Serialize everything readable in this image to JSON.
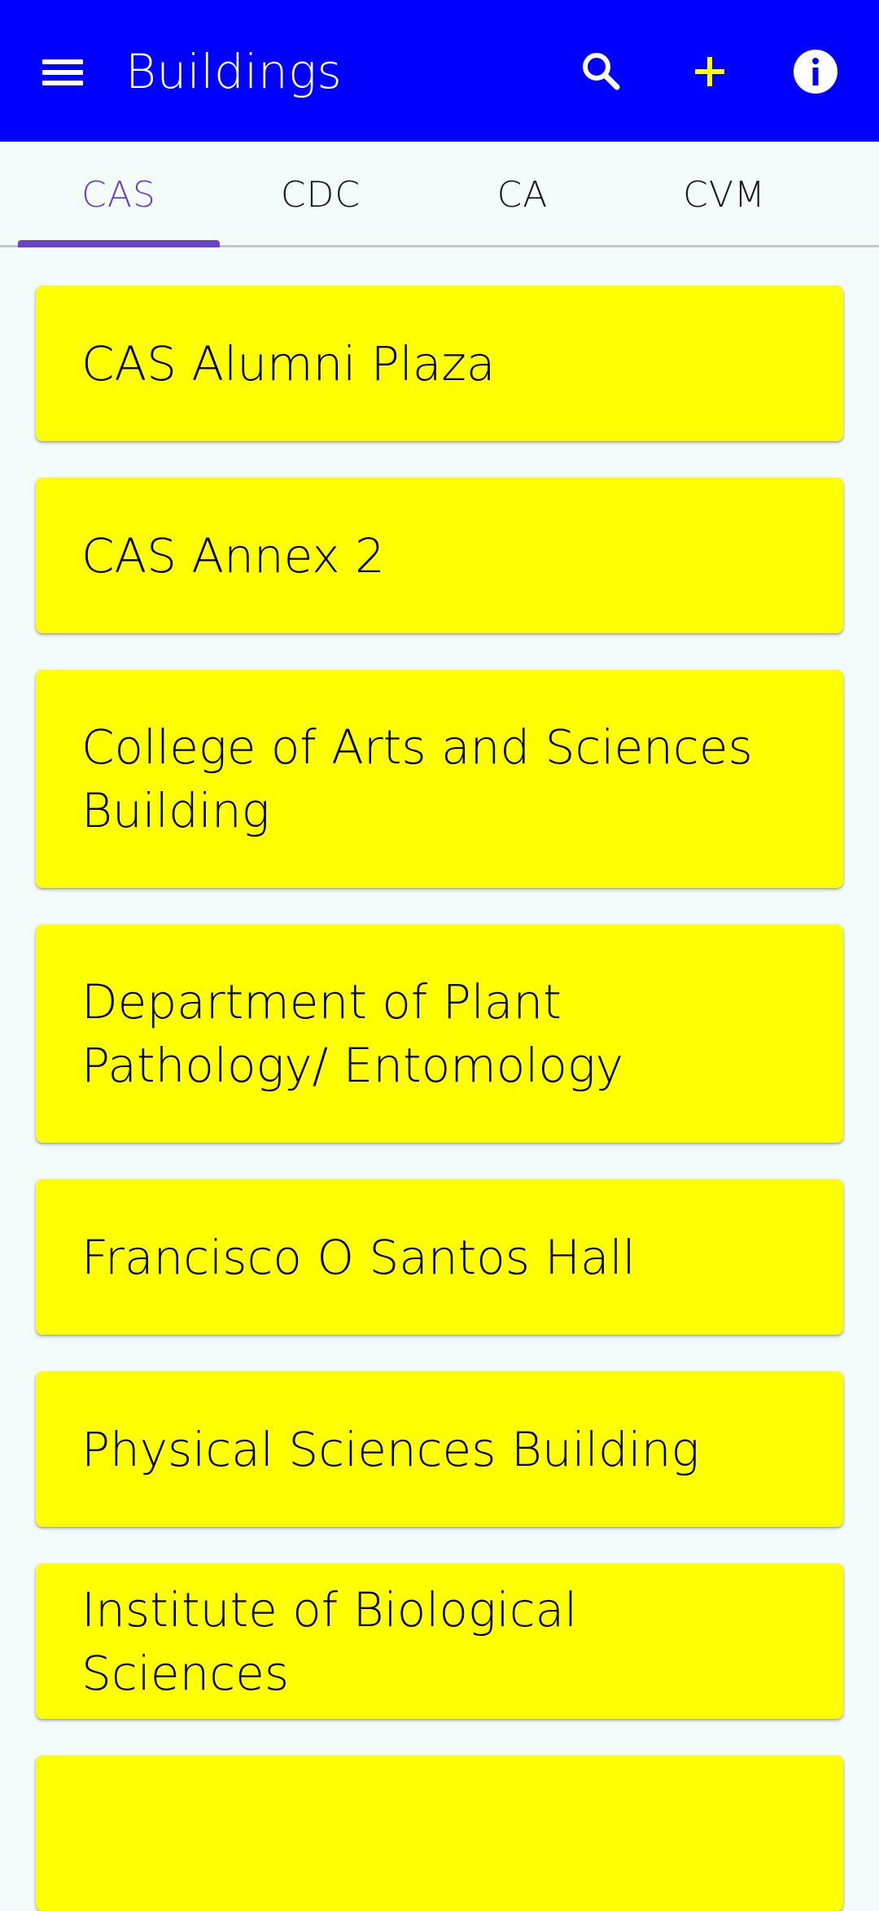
{
  "app_bar": {
    "title": "Buildings",
    "icons": {
      "menu": "menu-icon",
      "search": "search-icon",
      "add": "add-icon",
      "info": "info-icon"
    }
  },
  "tabs": [
    {
      "label": "CAS",
      "active": true
    },
    {
      "label": "CDC",
      "active": false
    },
    {
      "label": "CA",
      "active": false
    },
    {
      "label": "CVM",
      "active": false
    }
  ],
  "buildings": [
    "CAS Alumni Plaza",
    "CAS Annex 2",
    "College of Arts and Sciences Building",
    "Department of Plant Pathology/ Entomology",
    "Francisco O Santos Hall",
    "Physical Sciences Building",
    "Institute of Biological Sciences"
  ],
  "colors": {
    "app_bar": "#0000ff",
    "add_icon": "#ffff00",
    "active_tab": "#6b44c6",
    "card": "#ffff00",
    "background": "#f4fbfb"
  }
}
